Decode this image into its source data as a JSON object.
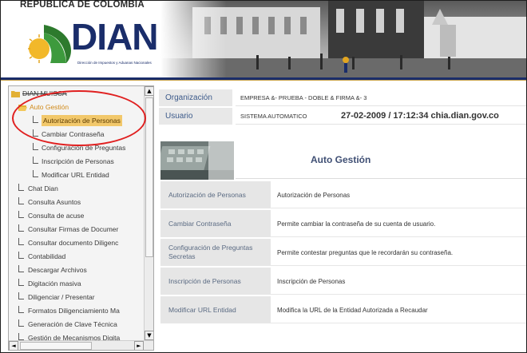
{
  "header": {
    "country": "REPUBLICA DE COLOMBIA",
    "logo_text": "DIAN",
    "logo_subtitle": "Dirección de Impuestos y Aduanas Nacionales",
    "colors": {
      "brand_blue": "#1a2d6a",
      "brand_green": "#2d7a2d",
      "brand_gold": "#e2a520"
    }
  },
  "sidebar": {
    "root_label": "DIAN MUISCA",
    "items": [
      {
        "label": "Auto Gestión",
        "level": 1,
        "state": "open"
      },
      {
        "label": "Autorización de Personas",
        "level": 2,
        "state": "selected"
      },
      {
        "label": "Cambiar Contraseña",
        "level": 2
      },
      {
        "label": "Configuración de Preguntas",
        "level": 2
      },
      {
        "label": "Inscripción de Personas",
        "level": 2
      },
      {
        "label": "Modificar URL Entidad",
        "level": 2
      },
      {
        "label": "Chat Dian",
        "level": 1
      },
      {
        "label": "Consulta Asuntos",
        "level": 1
      },
      {
        "label": "Consulta de acuse",
        "level": 1
      },
      {
        "label": "Consultar Firmas de Documer",
        "level": 1
      },
      {
        "label": "Consultar documento Diligenc",
        "level": 1
      },
      {
        "label": "Contabilidad",
        "level": 1
      },
      {
        "label": "Descargar Archivos",
        "level": 1
      },
      {
        "label": "Digitación masiva",
        "level": 1
      },
      {
        "label": "Diligenciar / Presentar",
        "level": 1
      },
      {
        "label": "Formatos Diligenciamiento Ma",
        "level": 1
      },
      {
        "label": "Generación de Clave Técnica",
        "level": 1
      },
      {
        "label": "Gestión de Mecanismos Digita",
        "level": 1
      }
    ],
    "scroll_up_icon": "▲",
    "scroll_down_icon": "▼",
    "scroll_left_icon": "◄",
    "scroll_right_icon": "►",
    "highlight_color": "#f2c86b",
    "annotation_color": "#e02020"
  },
  "info": {
    "org_label": "Organización",
    "org_value": "EMPRESA &- PRUEBA - DOBLE & FIRMA &- 3",
    "user_label": "Usuario",
    "user_value": "SISTEMA AUTOMATICO",
    "datetime": "27-02-2009 / 17:12:34 chia.dian.gov.co"
  },
  "section": {
    "title": "Auto Gestión"
  },
  "options": [
    {
      "name": "Autorización de Personas",
      "desc": "Autorización de Personas"
    },
    {
      "name": "Cambiar Contraseña",
      "desc": "Permite cambiar la contraseña de su cuenta de usuario."
    },
    {
      "name": "Configuración de Preguntas Secretas",
      "desc": "Permite contestar preguntas que le recordarán su contraseña."
    },
    {
      "name": "Inscripción de Personas",
      "desc": "Inscripción de Personas"
    },
    {
      "name": "Modificar URL Entidad",
      "desc": "Modifica la URL de la Entidad Autorizada a Recaudar"
    }
  ]
}
